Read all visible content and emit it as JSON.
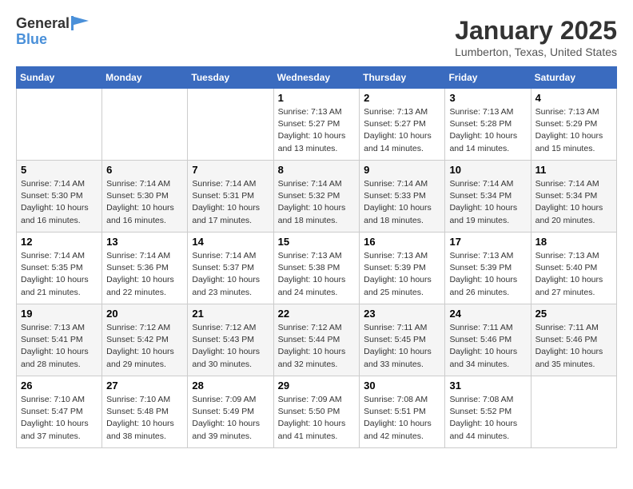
{
  "header": {
    "logo_line1": "General",
    "logo_line2": "Blue",
    "title": "January 2025",
    "subtitle": "Lumberton, Texas, United States"
  },
  "days_of_week": [
    "Sunday",
    "Monday",
    "Tuesday",
    "Wednesday",
    "Thursday",
    "Friday",
    "Saturday"
  ],
  "weeks": [
    [
      {
        "num": "",
        "info": ""
      },
      {
        "num": "",
        "info": ""
      },
      {
        "num": "",
        "info": ""
      },
      {
        "num": "1",
        "info": "Sunrise: 7:13 AM\nSunset: 5:27 PM\nDaylight: 10 hours\nand 13 minutes."
      },
      {
        "num": "2",
        "info": "Sunrise: 7:13 AM\nSunset: 5:27 PM\nDaylight: 10 hours\nand 14 minutes."
      },
      {
        "num": "3",
        "info": "Sunrise: 7:13 AM\nSunset: 5:28 PM\nDaylight: 10 hours\nand 14 minutes."
      },
      {
        "num": "4",
        "info": "Sunrise: 7:13 AM\nSunset: 5:29 PM\nDaylight: 10 hours\nand 15 minutes."
      }
    ],
    [
      {
        "num": "5",
        "info": "Sunrise: 7:14 AM\nSunset: 5:30 PM\nDaylight: 10 hours\nand 16 minutes."
      },
      {
        "num": "6",
        "info": "Sunrise: 7:14 AM\nSunset: 5:30 PM\nDaylight: 10 hours\nand 16 minutes."
      },
      {
        "num": "7",
        "info": "Sunrise: 7:14 AM\nSunset: 5:31 PM\nDaylight: 10 hours\nand 17 minutes."
      },
      {
        "num": "8",
        "info": "Sunrise: 7:14 AM\nSunset: 5:32 PM\nDaylight: 10 hours\nand 18 minutes."
      },
      {
        "num": "9",
        "info": "Sunrise: 7:14 AM\nSunset: 5:33 PM\nDaylight: 10 hours\nand 18 minutes."
      },
      {
        "num": "10",
        "info": "Sunrise: 7:14 AM\nSunset: 5:34 PM\nDaylight: 10 hours\nand 19 minutes."
      },
      {
        "num": "11",
        "info": "Sunrise: 7:14 AM\nSunset: 5:34 PM\nDaylight: 10 hours\nand 20 minutes."
      }
    ],
    [
      {
        "num": "12",
        "info": "Sunrise: 7:14 AM\nSunset: 5:35 PM\nDaylight: 10 hours\nand 21 minutes."
      },
      {
        "num": "13",
        "info": "Sunrise: 7:14 AM\nSunset: 5:36 PM\nDaylight: 10 hours\nand 22 minutes."
      },
      {
        "num": "14",
        "info": "Sunrise: 7:14 AM\nSunset: 5:37 PM\nDaylight: 10 hours\nand 23 minutes."
      },
      {
        "num": "15",
        "info": "Sunrise: 7:13 AM\nSunset: 5:38 PM\nDaylight: 10 hours\nand 24 minutes."
      },
      {
        "num": "16",
        "info": "Sunrise: 7:13 AM\nSunset: 5:39 PM\nDaylight: 10 hours\nand 25 minutes."
      },
      {
        "num": "17",
        "info": "Sunrise: 7:13 AM\nSunset: 5:39 PM\nDaylight: 10 hours\nand 26 minutes."
      },
      {
        "num": "18",
        "info": "Sunrise: 7:13 AM\nSunset: 5:40 PM\nDaylight: 10 hours\nand 27 minutes."
      }
    ],
    [
      {
        "num": "19",
        "info": "Sunrise: 7:13 AM\nSunset: 5:41 PM\nDaylight: 10 hours\nand 28 minutes."
      },
      {
        "num": "20",
        "info": "Sunrise: 7:12 AM\nSunset: 5:42 PM\nDaylight: 10 hours\nand 29 minutes."
      },
      {
        "num": "21",
        "info": "Sunrise: 7:12 AM\nSunset: 5:43 PM\nDaylight: 10 hours\nand 30 minutes."
      },
      {
        "num": "22",
        "info": "Sunrise: 7:12 AM\nSunset: 5:44 PM\nDaylight: 10 hours\nand 32 minutes."
      },
      {
        "num": "23",
        "info": "Sunrise: 7:11 AM\nSunset: 5:45 PM\nDaylight: 10 hours\nand 33 minutes."
      },
      {
        "num": "24",
        "info": "Sunrise: 7:11 AM\nSunset: 5:46 PM\nDaylight: 10 hours\nand 34 minutes."
      },
      {
        "num": "25",
        "info": "Sunrise: 7:11 AM\nSunset: 5:46 PM\nDaylight: 10 hours\nand 35 minutes."
      }
    ],
    [
      {
        "num": "26",
        "info": "Sunrise: 7:10 AM\nSunset: 5:47 PM\nDaylight: 10 hours\nand 37 minutes."
      },
      {
        "num": "27",
        "info": "Sunrise: 7:10 AM\nSunset: 5:48 PM\nDaylight: 10 hours\nand 38 minutes."
      },
      {
        "num": "28",
        "info": "Sunrise: 7:09 AM\nSunset: 5:49 PM\nDaylight: 10 hours\nand 39 minutes."
      },
      {
        "num": "29",
        "info": "Sunrise: 7:09 AM\nSunset: 5:50 PM\nDaylight: 10 hours\nand 41 minutes."
      },
      {
        "num": "30",
        "info": "Sunrise: 7:08 AM\nSunset: 5:51 PM\nDaylight: 10 hours\nand 42 minutes."
      },
      {
        "num": "31",
        "info": "Sunrise: 7:08 AM\nSunset: 5:52 PM\nDaylight: 10 hours\nand 44 minutes."
      },
      {
        "num": "",
        "info": ""
      }
    ]
  ]
}
